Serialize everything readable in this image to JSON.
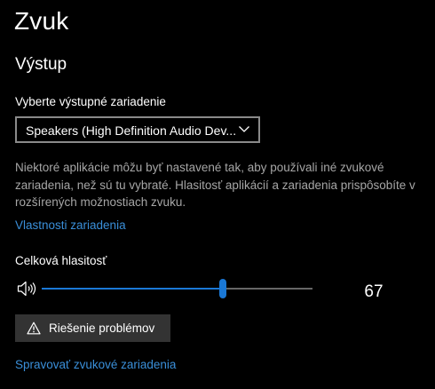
{
  "page": {
    "title": "Zvuk"
  },
  "output": {
    "section_title": "Výstup",
    "device_label": "Vyberte výstupné zariadenie",
    "device_selected": "Speakers (High Definition Audio Dev...",
    "info_text": "Niektoré aplikácie môžu byť nastavené tak, aby používali iné zvukové zariadenia, než sú tu vybraté. Hlasitosť aplikácií a zariadenia prispôsobíte v rozšírených možnostiach zvuku.",
    "device_properties_link": "Vlastnosti zariadenia",
    "volume_label": "Celková hlasitosť",
    "volume_value": 67,
    "troubleshoot_label": "Riešenie problémov",
    "manage_devices_link": "Spravovať zvukové zariadenia"
  },
  "icons": {
    "dropdown": "chevron-down-icon",
    "volume": "speaker-icon",
    "troubleshoot": "warning-icon"
  },
  "colors": {
    "background": "#000000",
    "accent": "#1a78d6",
    "link": "#3a8fd9",
    "secondary_text": "#a6a6a6",
    "button_background": "#333333"
  }
}
